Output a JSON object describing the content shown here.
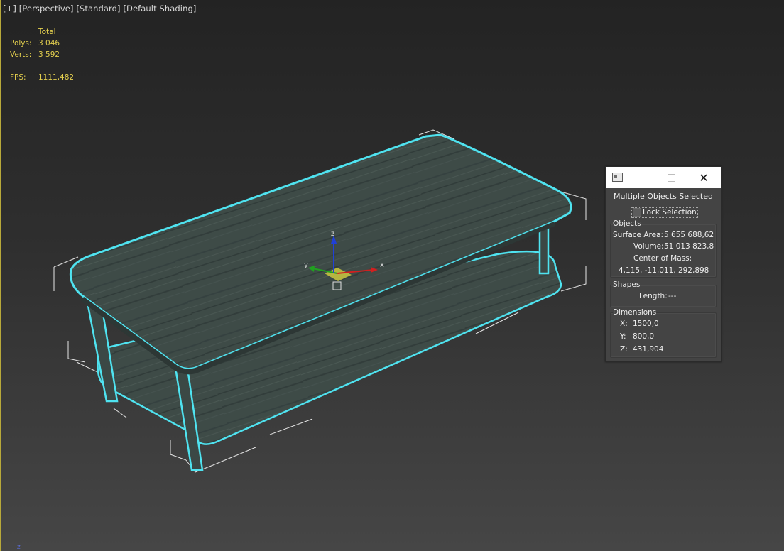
{
  "viewport": {
    "labels": [
      "[+]",
      "[Perspective]",
      "[Standard]",
      "[Default Shading]"
    ],
    "stats": {
      "header": "Total",
      "polys_label": "Polys:",
      "polys_value": "3 046",
      "verts_label": "Verts:",
      "verts_value": "3 592",
      "fps_label": "FPS:",
      "fps_value": "1111,482"
    },
    "gizmo": {
      "x_label": "x",
      "y_label": "y",
      "z_label": "z"
    },
    "corner_axis_label": "z",
    "colors": {
      "stats_text": "#e3cf4e",
      "selection_outline": "#4fe3f0",
      "wood": "#3d4a46",
      "gizmo_x": "#d02020",
      "gizmo_y": "#20a020",
      "gizmo_z": "#2040d8"
    }
  },
  "dialog": {
    "title": "Multiple Objects Selected",
    "lock_selection_label": "Lock Selection",
    "lock_selection_checked": false,
    "objects": {
      "group_label": "Objects",
      "surface_area_label": "Surface Area:",
      "surface_area_value": "5 655 688,62",
      "volume_label": "Volume:",
      "volume_value": "51 013 823,8",
      "center_of_mass_label": "Center of Mass:",
      "center_of_mass_value": "4,115, -11,011, 292,898"
    },
    "shapes": {
      "group_label": "Shapes",
      "length_label": "Length:",
      "length_value": "---"
    },
    "dimensions": {
      "group_label": "Dimensions",
      "x_label": "X:",
      "x_value": "1500,0",
      "y_label": "Y:",
      "y_value": "800,0",
      "z_label": "Z:",
      "z_value": "431,904"
    },
    "window_buttons": [
      "minimize-icon",
      "maximize-icon",
      "close-icon"
    ]
  }
}
